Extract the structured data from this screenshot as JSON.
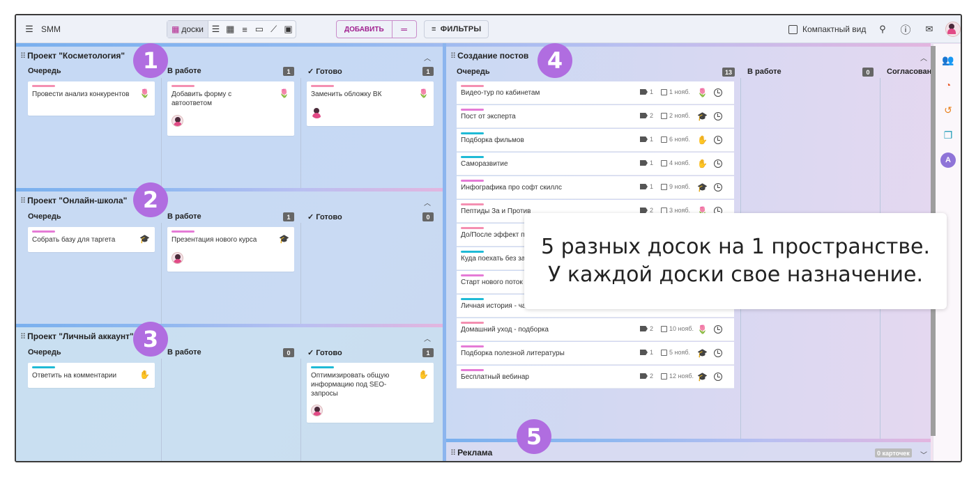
{
  "app": {
    "title": "SMM"
  },
  "toolbar": {
    "boards_label": "доски",
    "add_label": "ДОБАВИТЬ",
    "filters_label": "ФИЛЬТРЫ",
    "compact_label": "Компактный вид"
  },
  "boards": [
    {
      "title": "Проект \"Косметология\"",
      "badge": "1",
      "columns": [
        {
          "name": "Очередь",
          "count": "",
          "cards": [
            {
              "text": "Провести анализ конкурентов",
              "color": "#f48fb1",
              "icon": "tulip-icon"
            }
          ]
        },
        {
          "name": "В работе",
          "count": "1",
          "cards": [
            {
              "text": "Добавить форму с автоответом",
              "color": "#f48fb1",
              "icon": "tulip-icon"
            }
          ]
        },
        {
          "name": "✓ Готово",
          "count": "1",
          "cards": [
            {
              "text": "Заменить обложку ВК",
              "color": "#f48fb1",
              "icon": "tulip-icon"
            }
          ]
        }
      ]
    },
    {
      "title": "Проект \"Онлайн-школа\"",
      "badge": "2",
      "columns": [
        {
          "name": "Очередь",
          "count": "",
          "cards": [
            {
              "text": "Собрать базу для таргета",
              "color": "#e57bd6",
              "icon": "cap-icon"
            }
          ]
        },
        {
          "name": "В работе",
          "count": "1",
          "cards": [
            {
              "text": "Презентация нового курса",
              "color": "#e57bd6",
              "icon": "cap-icon"
            }
          ]
        },
        {
          "name": "✓ Готово",
          "count": "0",
          "cards": []
        }
      ]
    },
    {
      "title": "Проект \"Личный аккаунт\"",
      "badge": "3",
      "columns": [
        {
          "name": "Очередь",
          "count": "",
          "cards": [
            {
              "text": "Ответить на комментарии",
              "color": "#1fbad6",
              "icon": "hand-icon"
            }
          ]
        },
        {
          "name": "В работе",
          "count": "0",
          "cards": []
        },
        {
          "name": "✓ Готово",
          "count": "1",
          "cards": [
            {
              "text": "Оптимизировать общую информацию под SEO-запросы",
              "color": "#1fbad6",
              "icon": "hand-icon"
            }
          ]
        }
      ]
    }
  ],
  "posts_board": {
    "title": "Создание постов",
    "badge": "4",
    "col1": "Очередь",
    "col1_count": "13",
    "col2": "В работе",
    "col2_count": "0",
    "col3": "Согласовани",
    "rows": [
      {
        "text": "Видео-тур по кабинетам",
        "tags": "1",
        "date": "1 нояб.",
        "color": "#f48fb1",
        "icon": "tulip-icon"
      },
      {
        "text": "Пост от эксперта",
        "tags": "2",
        "date": "2 нояб.",
        "color": "#e57bd6",
        "icon": "cap-icon"
      },
      {
        "text": "Подборка фильмов",
        "tags": "1",
        "date": "6 нояб.",
        "color": "#1fbad6",
        "icon": "hand-icon"
      },
      {
        "text": "Саморазвитие",
        "tags": "1",
        "date": "4 нояб.",
        "color": "#1fbad6",
        "icon": "hand-icon"
      },
      {
        "text": "Инфографика про софт скиллс",
        "tags": "1",
        "date": "9 нояб.",
        "color": "#e57bd6",
        "icon": "cap-icon"
      },
      {
        "text": "Пептиды За и Против",
        "tags": "2",
        "date": "3 нояб.",
        "color": "#f48fb1",
        "icon": "tulip-icon"
      },
      {
        "text": "До/После эффект п",
        "tags": "",
        "date": "",
        "color": "#f48fb1",
        "icon": ""
      },
      {
        "text": "Куда поехать без за",
        "tags": "",
        "date": "",
        "color": "#1fbad6",
        "icon": ""
      },
      {
        "text": "Старт нового поток",
        "tags": "",
        "date": "",
        "color": "#e57bd6",
        "icon": ""
      },
      {
        "text": "Личная история - ча",
        "tags": "",
        "date": "",
        "color": "#1fbad6",
        "icon": ""
      },
      {
        "text": "Домашний уход - подборка",
        "tags": "2",
        "date": "10 нояб.",
        "color": "#f48fb1",
        "icon": "tulip-icon"
      },
      {
        "text": "Подборка полезной литературы",
        "tags": "1",
        "date": "5 нояб.",
        "color": "#e57bd6",
        "icon": "cap-icon"
      },
      {
        "text": "Бесплатный вебинар",
        "tags": "2",
        "date": "12 нояб.",
        "color": "#e57bd6",
        "icon": "cap-icon"
      }
    ]
  },
  "ads_board": {
    "title": "Реклама",
    "badge": "5",
    "count_label": "0 карточек"
  },
  "callout": {
    "line1": "5 разных досок на 1 пространстве.",
    "line2": "У каждой доски свое назначение."
  }
}
